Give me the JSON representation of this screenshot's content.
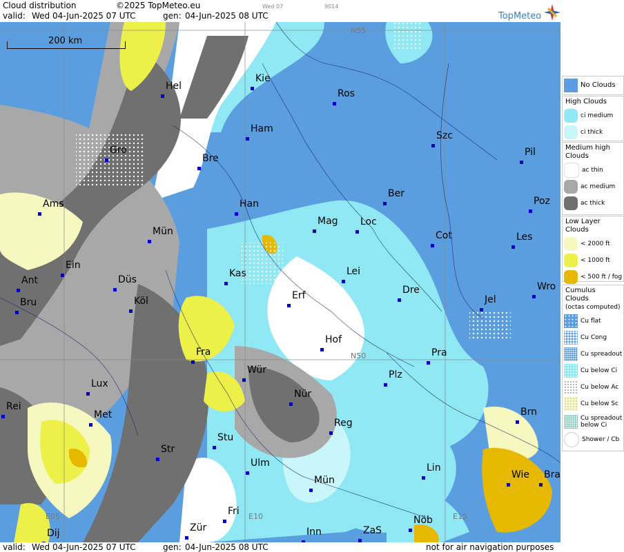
{
  "header": {
    "title": "Cloud distribution",
    "copyright": "©2025 TopMeteo.eu",
    "day_tag": "Wed 07",
    "run_tag": "9014",
    "valid_label": "valid:",
    "valid_value": "Wed  04-Jun-2025  07 UTC",
    "gen_label": "gen:",
    "gen_value": "04-Jun-2025 08 UTC",
    "brand": "TopMeteo"
  },
  "footer": {
    "valid_label": "valid:",
    "valid_value": "Wed  04-Jun-2025  07 UTC",
    "gen_label": "gen:",
    "gen_value": "04-Jun-2025 08 UTC",
    "disclaimer": "not for air navigation purposes"
  },
  "map": {
    "scale": "200 km",
    "grid_labels": [
      "N55",
      "N50",
      "E05",
      "E10",
      "E15"
    ],
    "cities": [
      "Kie",
      "Hel",
      "Ros",
      "Ham",
      "Szc",
      "Gro",
      "Bre",
      "Pil",
      "Ber",
      "Ams",
      "Han",
      "Poz",
      "Mag",
      "Loc",
      "Mün",
      "Cot",
      "Les",
      "Ein",
      "Kas",
      "Lei",
      "Ant",
      "Düs",
      "Wro",
      "Erf",
      "Dre",
      "Bru",
      "Köl",
      "Jel",
      "Hof",
      "Fra",
      "Pra",
      "Lux",
      "Wür",
      "Plz",
      "Rei",
      "Nür",
      "Met",
      "Reg",
      "Brn",
      "Stu",
      "Str",
      "Ulm",
      "Lin",
      "Mün",
      "Wie",
      "Bra",
      "Fri",
      "Zür",
      "Inn",
      "ZaS",
      "Nöb",
      "Dij"
    ]
  },
  "legend": {
    "no_clouds": "No Clouds",
    "high_title": "High Clouds",
    "high": [
      "ci medium",
      "ci thick"
    ],
    "medium_title": "Medium high Clouds",
    "medium": [
      "ac thin",
      "ac medium",
      "ac thick"
    ],
    "low_title": "Low Layer Clouds",
    "low": [
      "< 2000 ft",
      "< 1000 ft",
      "< 500 ft / fog"
    ],
    "cumulus_title": "Cumulus Clouds",
    "cumulus_sub": "(octas computed)",
    "cumulus": [
      "Cu flat",
      "Cu Cong",
      "Cu spreadout",
      "Cu below Ci",
      "Cu below Ac",
      "Cu below Sc",
      "Cu spreadout below Ci",
      "Shower / Cb"
    ]
  },
  "colors": {
    "no_clouds": "#5b9ee0",
    "ci_medium": "#8fe8f4",
    "ci_thick": "#c8f6fa",
    "ac_thin": "#ffffff",
    "ac_medium": "#a8a8a8",
    "ac_thick": "#707070",
    "low_2000": "#f6f8c0",
    "low_1000": "#eef04a",
    "low_500": "#e6b800"
  }
}
